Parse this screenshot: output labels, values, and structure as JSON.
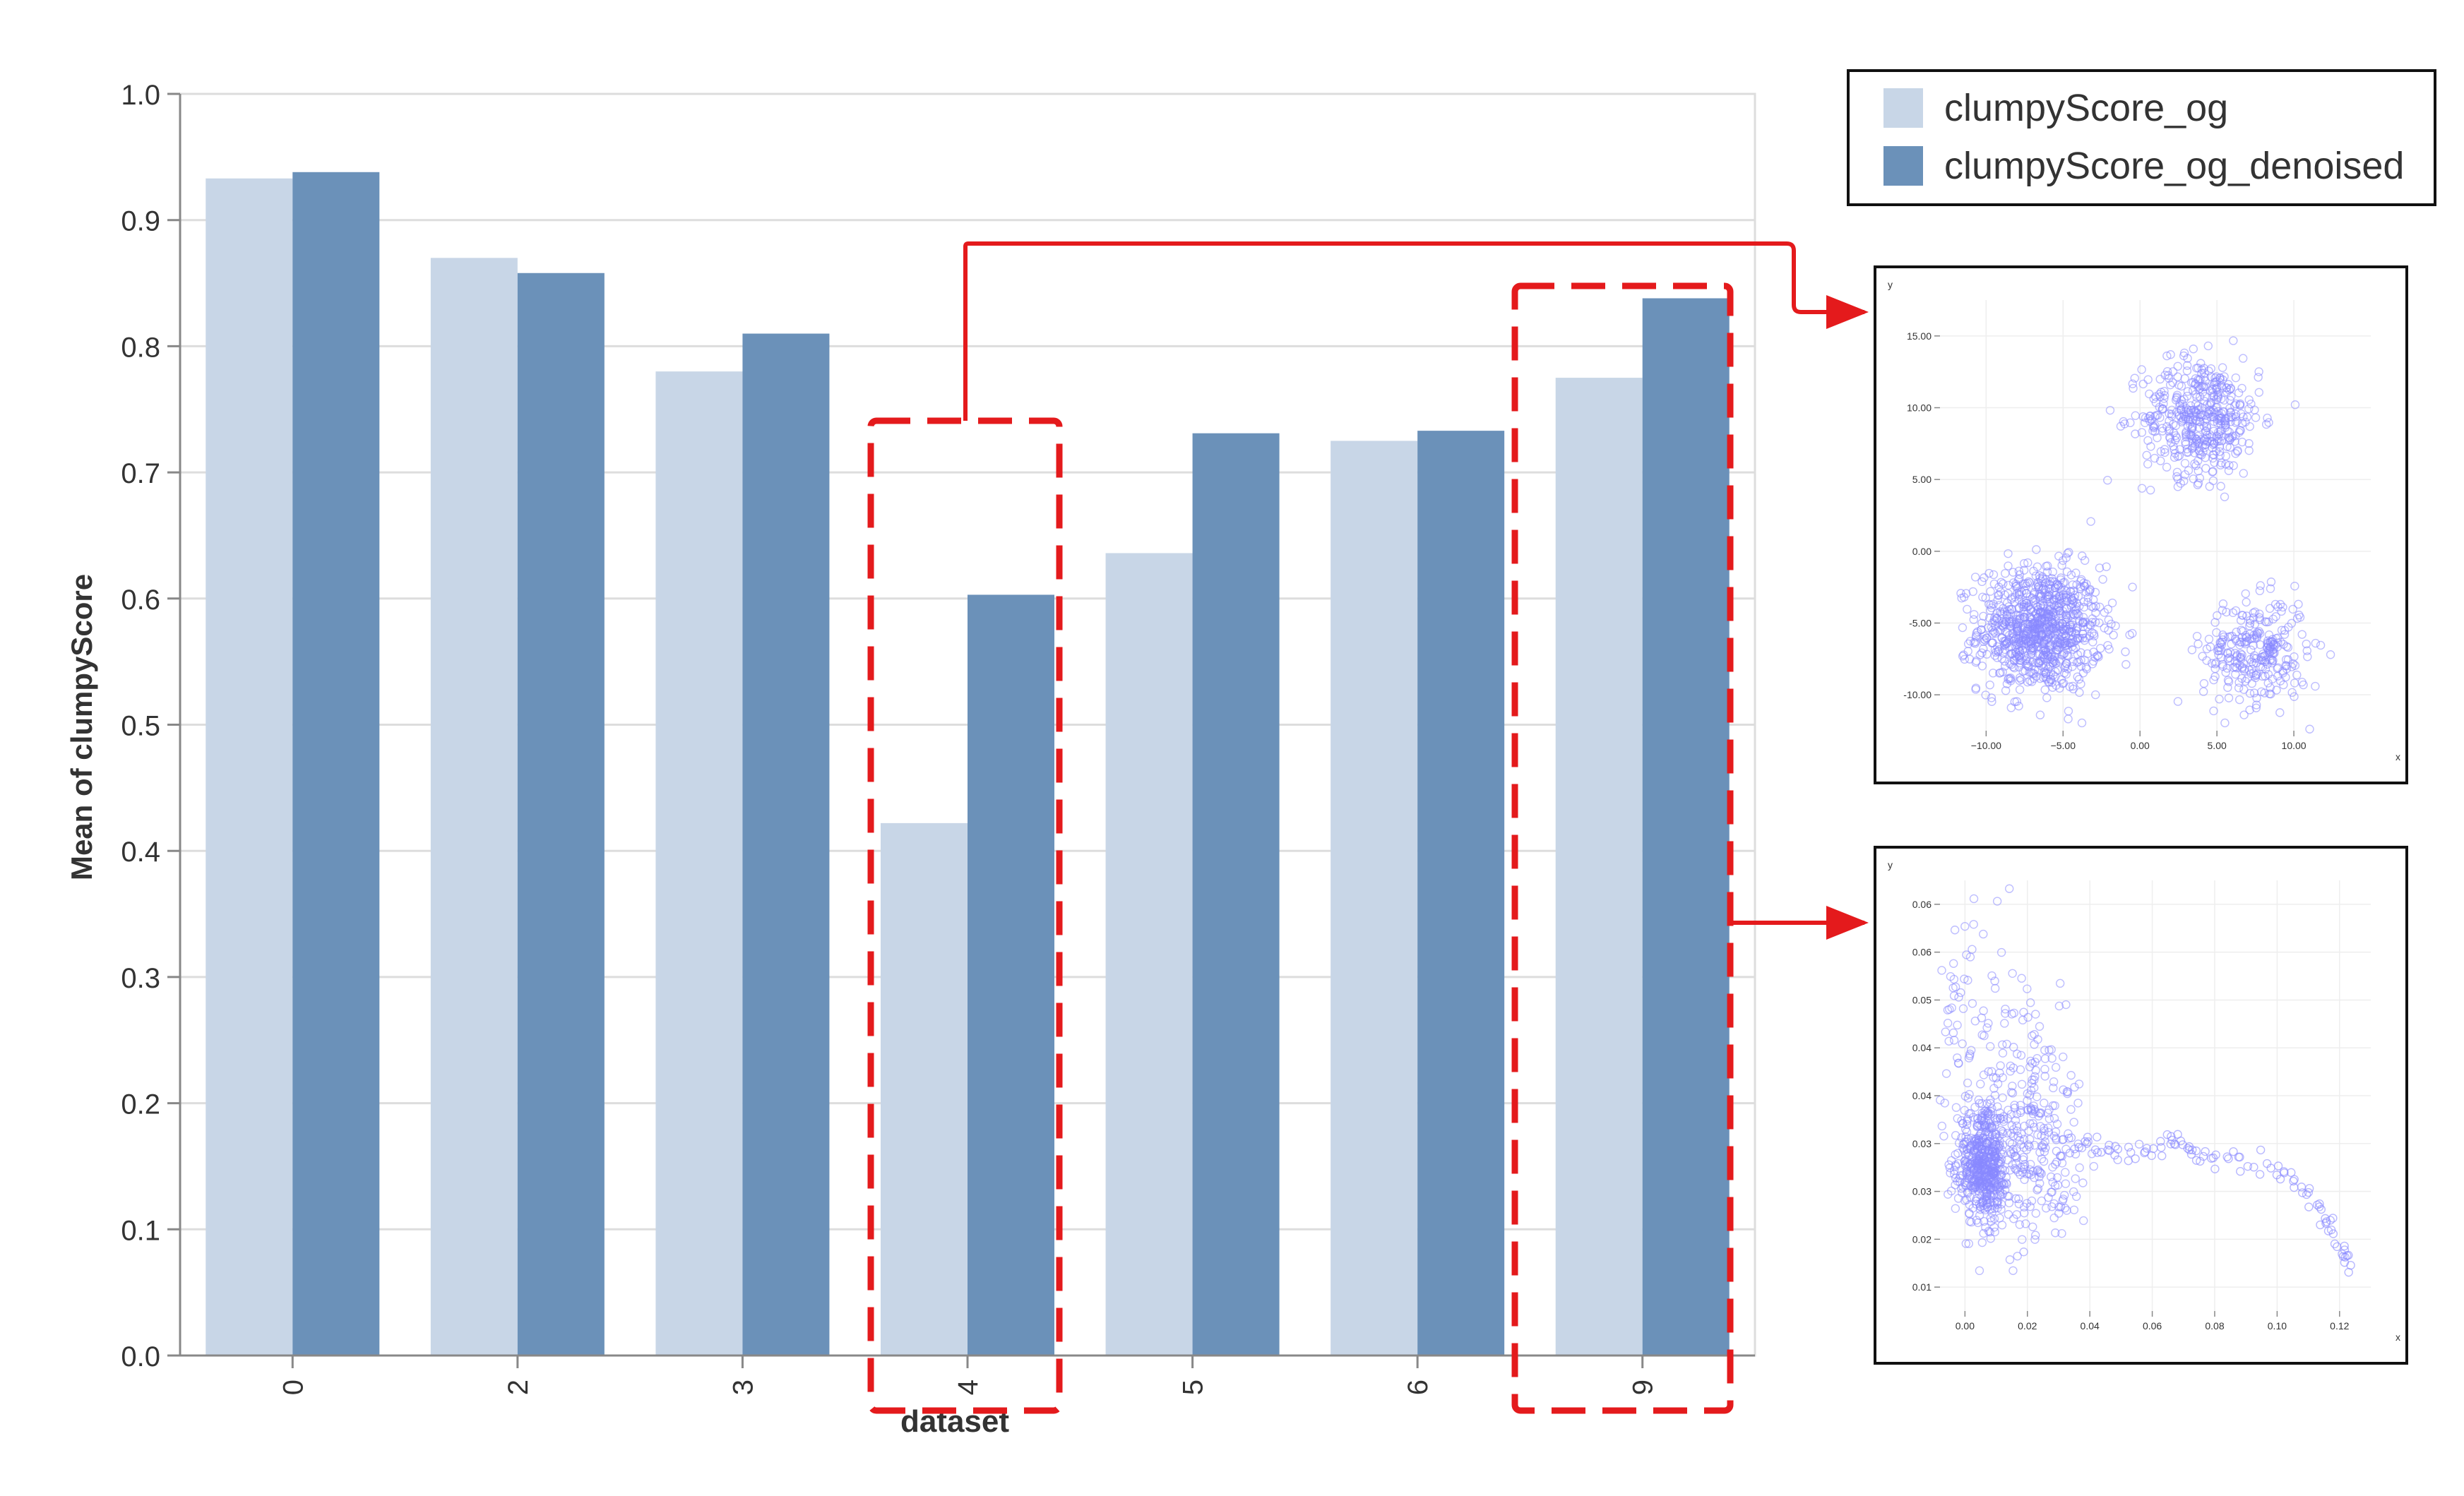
{
  "chart_data": [
    {
      "type": "bar",
      "title": "",
      "xlabel": "dataset",
      "ylabel": "Mean of clumpyScore",
      "categories": [
        "0",
        "2",
        "3",
        "4",
        "5",
        "6",
        "9"
      ],
      "series": [
        {
          "name": "clumpyScore_og",
          "color": "#c8d6e7",
          "values": [
            0.933,
            0.87,
            0.78,
            0.422,
            0.636,
            0.725,
            0.775
          ]
        },
        {
          "name": "clumpyScore_og_denoised",
          "color": "#6b91b9",
          "values": [
            0.938,
            0.858,
            0.81,
            0.603,
            0.731,
            0.733,
            0.838
          ]
        }
      ],
      "ylim": [
        0,
        1
      ],
      "yticks": [
        "0.0",
        "0.1",
        "0.2",
        "0.3",
        "0.4",
        "0.5",
        "0.6",
        "0.7",
        "0.8",
        "0.9",
        "1.0"
      ],
      "grid": true,
      "legend": "top-right",
      "highlighted_categories": [
        "4",
        "9"
      ],
      "highlight_color": "#e41a1c"
    },
    {
      "type": "scatter",
      "xlabel": "x",
      "ylabel": "y",
      "xticks": [
        "-10.00",
        "-5.00",
        "0.00",
        "5.00",
        "10.00"
      ],
      "yticks": [
        "-10.00",
        "-5.00",
        "0.00",
        "5.00",
        "10.00",
        "15.00"
      ],
      "xlim": [
        -13,
        15
      ],
      "ylim": [
        -11.5,
        16
      ],
      "point_color": "#8888ff",
      "clusters": [
        {
          "center": [
            -6.5,
            -5
          ],
          "spread": 2.0,
          "count": 900
        },
        {
          "center": [
            4,
            8.5
          ],
          "spread": 1.9,
          "count": 450
        },
        {
          "center": [
            7.5,
            -6.5
          ],
          "spread": 1.7,
          "count": 280
        }
      ]
    },
    {
      "type": "scatter",
      "xlabel": "x",
      "ylabel": "y",
      "xticks": [
        "0.00",
        "0.02",
        "0.04",
        "0.06",
        "0.08",
        "0.10",
        "0.12"
      ],
      "yticks": [
        "0.01",
        "0.02",
        "0.03",
        "0.03",
        "0.04",
        "0.04",
        "0.05",
        "0.06",
        "0.06"
      ],
      "xlim": [
        -0.008,
        0.13
      ],
      "ylim": [
        0.004,
        0.068
      ],
      "point_color": "#8888ff",
      "clusters": [
        {
          "center": [
            0.006,
            0.0255
          ],
          "spread": 0.004,
          "count": 500
        },
        {
          "center": [
            0.003,
            0.04
          ],
          "spread": 0.012,
          "count": 160
        },
        {
          "center": [
            0.022,
            0.029
          ],
          "spread": 0.008,
          "count": 250
        }
      ],
      "trail": [
        [
          0.03,
          0.029
        ],
        [
          0.04,
          0.0285
        ],
        [
          0.05,
          0.0275
        ],
        [
          0.06,
          0.028
        ],
        [
          0.068,
          0.0295
        ],
        [
          0.075,
          0.027
        ],
        [
          0.085,
          0.0265
        ],
        [
          0.1,
          0.0255
        ],
        [
          0.108,
          0.022
        ],
        [
          0.115,
          0.018
        ],
        [
          0.12,
          0.0135
        ],
        [
          0.123,
          0.0105
        ]
      ]
    }
  ],
  "legend": {
    "items": [
      {
        "label": "clumpyScore_og",
        "color": "#c8d6e7"
      },
      {
        "label": "clumpyScore_og_denoised",
        "color": "#6b91b9"
      }
    ]
  }
}
